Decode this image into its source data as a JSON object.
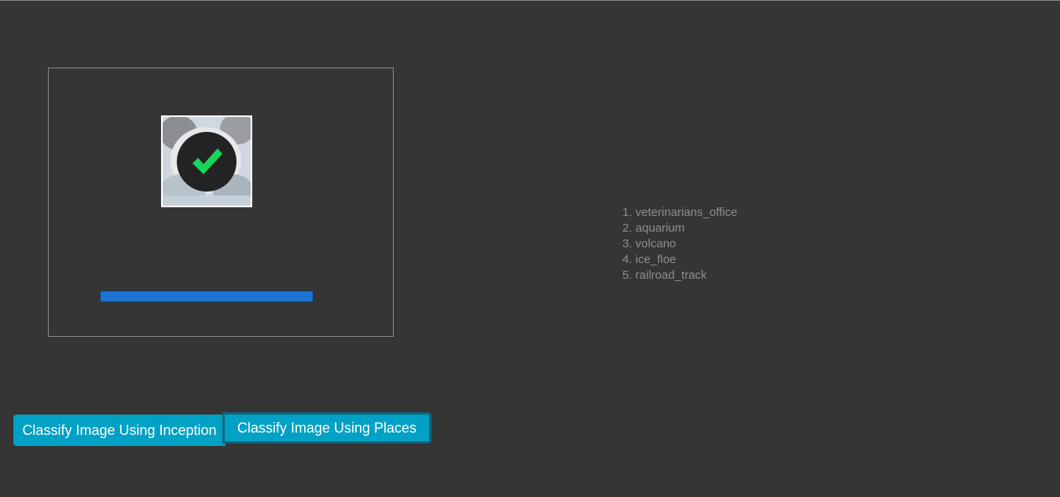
{
  "uploader": {
    "thumbnail_icon": "panda-photo",
    "status_icon": "checkmark-icon",
    "status_color": "#19d45a",
    "progress": 1.0,
    "progress_color": "#1f73d1"
  },
  "results": {
    "items": [
      {
        "label": "1. veterinarians_office"
      },
      {
        "label": "2. aquarium"
      },
      {
        "label": "3. volcano"
      },
      {
        "label": "4. ice_floe"
      },
      {
        "label": "5. railroad_track"
      }
    ]
  },
  "actions": {
    "inception_label": "Classify Image Using Inception",
    "places_label": "Classify Image Using Places",
    "button_color": "#00a1c4"
  }
}
